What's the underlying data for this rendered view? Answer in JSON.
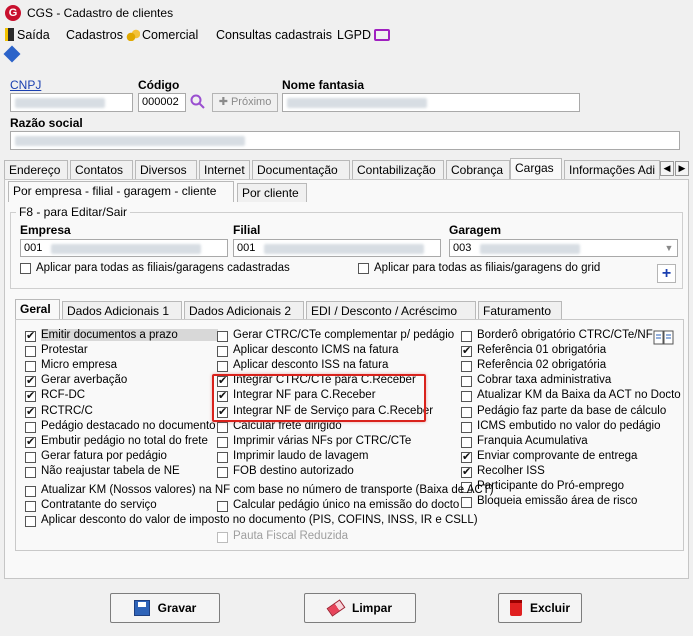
{
  "window": {
    "title": "CGS - Cadastro de clientes",
    "app_icon": "G"
  },
  "menu": {
    "saida": "Saída",
    "cadastros": "Cadastros",
    "comercial": "Comercial",
    "consultas": "Consultas cadastrais",
    "lgpd": "LGPD"
  },
  "header": {
    "cnpj_label": "CNPJ",
    "codigo_label": "Código",
    "codigo_value": "000002",
    "proximo_label": "Próximo",
    "nome_fantasia_label": "Nome fantasia",
    "razao_social_label": "Razão social"
  },
  "tabs": {
    "main": [
      "Endereço",
      "Contatos",
      "Diversos",
      "Internet",
      "Documentação",
      "Contabilização",
      "Cobrança",
      "Cargas",
      "Informações Adi"
    ],
    "active_main": "Cargas",
    "sub": [
      "Por empresa - filial - garagem - cliente",
      "Por cliente"
    ],
    "inner": [
      "Geral",
      "Dados Adicionais 1",
      "Dados Adicionais 2",
      "EDI / Desconto / Acréscimo",
      "Faturamento"
    ]
  },
  "edit_panel": {
    "caption": "F8 - para Editar/Sair",
    "empresa_label": "Empresa",
    "empresa_value": "001",
    "filial_label": "Filial",
    "filial_value": "001",
    "garagem_label": "Garagem",
    "garagem_value": "003",
    "apply_all_filiais": "Aplicar para todas as filiais/garagens cadastradas",
    "apply_all_grid": "Aplicar para todas as filiais/garagens do grid"
  },
  "checks_col1": [
    {
      "label": "Emitir documentos a prazo",
      "checked": true
    },
    {
      "label": "Protestar",
      "checked": false
    },
    {
      "label": "Micro empresa",
      "checked": false
    },
    {
      "label": "Gerar averbação",
      "checked": true
    },
    {
      "label": "RCF-DC",
      "checked": true
    },
    {
      "label": "RCTRC/C",
      "checked": true
    },
    {
      "label": "Pedágio destacado no documento",
      "checked": false
    },
    {
      "label": "Embutir pedágio no total do frete",
      "checked": true
    },
    {
      "label": "Gerar fatura por pedágio",
      "checked": false
    },
    {
      "label": "Não reajustar tabela de NE",
      "checked": false
    }
  ],
  "checks_col2": [
    {
      "label": "Gerar CTRC/CTe complementar p/ pedágio",
      "checked": false
    },
    {
      "label": "Aplicar desconto ICMS na fatura",
      "checked": false
    },
    {
      "label": "Aplicar desconto ISS na fatura",
      "checked": false
    },
    {
      "label": "Integrar CTRC/CTe para C.Receber",
      "checked": true
    },
    {
      "label": "Integrar NF para C.Receber",
      "checked": true
    },
    {
      "label": "Integrar NF de Serviço para C.Receber",
      "checked": true
    },
    {
      "label": "Calcular frete dirigido",
      "checked": false
    },
    {
      "label": "Imprimir várias NFs por CTRC/CTe",
      "checked": false
    },
    {
      "label": "Imprimir laudo de lavagem",
      "checked": false
    },
    {
      "label": "FOB destino autorizado",
      "checked": false
    }
  ],
  "checks_col3": [
    {
      "label": "Borderô obrigatório  CTRC/CTe/NF",
      "checked": false
    },
    {
      "label": "Referência 01 obrigatória",
      "checked": true
    },
    {
      "label": "Referência 02 obrigatória",
      "checked": false
    },
    {
      "label": "Cobrar taxa administrativa",
      "checked": false
    },
    {
      "label": "Atualizar KM da Baixa da ACT no Docto",
      "checked": false
    },
    {
      "label": "Pedágio faz parte da base de cálculo",
      "checked": false
    },
    {
      "label": "ICMS embutido no valor do pedágio",
      "checked": false
    },
    {
      "label": "Franquia Acumulativa",
      "checked": false
    },
    {
      "label": "Enviar comprovante de entrega",
      "checked": true
    },
    {
      "label": "Recolher ISS",
      "checked": true
    },
    {
      "label": "Participante do Pró-emprego",
      "checked": false
    },
    {
      "label": "Bloqueia emissão área de risco",
      "checked": false
    }
  ],
  "checks_wide": [
    {
      "label": "Atualizar KM (Nossos valores) na NF com base no número de transporte (Baixa de ACT)",
      "checked": false
    },
    {
      "label": "Contratante do serviço",
      "checked": false
    },
    {
      "label": "Calcular pedágio único na emissão do docto",
      "checked": false
    },
    {
      "label": "Aplicar desconto do valor de imposto no documento (PIS, COFINS, INSS, IR e CSLL)",
      "checked": false
    },
    {
      "label": "Pauta Fiscal Reduzida",
      "checked": false
    }
  ],
  "buttons": {
    "gravar": "Gravar",
    "limpar": "Limpar",
    "excluir": "Excluir"
  },
  "colors": {
    "highlight_box": "#d9221c",
    "link": "#1a3fb0"
  }
}
